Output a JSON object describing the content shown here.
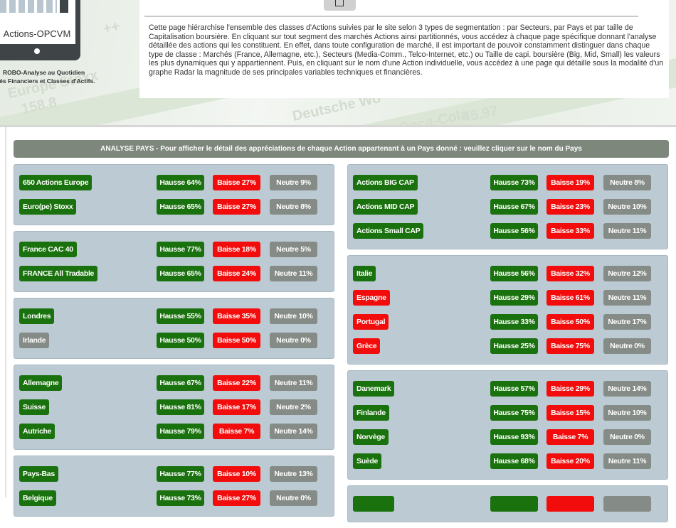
{
  "logo": {
    "text": "Actions-OPCVM",
    "tagline_1": "ROBO-Analyse au Quotidien",
    "tagline_2": "nés Financiers et Classes d'Actifs."
  },
  "background_ticker": [
    "Europe Stoxx",
    "158.8",
    "Deutsche Wo",
    "Coca-Cola",
    "45.97",
    "++"
  ],
  "intro": {
    "text": "Cette page hiérarchise l'ensemble des classes d'Actions suivies par le site selon 3 types de segmentation : par Secteurs, par Pays et par taille de Capitalisation boursière. En cliquant sur tout segment des marchés Actions ainsi partitionnés, vous accédez à chaque page spécifique donnant l'analyse détaillée des actions qui les constituent. En effet, dans toute configuration de marché, il est important de pouvoir constamment distinguer dans chaque type de classe : Marchés (France, Allemagne, etc.), Secteurs (Media-Comm., Telco-Internet, etc.) ou Taille de capi. boursière (Big, Mid, Small) les valeurs les plus dynamiques qui y appartiennent. Puis, en cliquant sur le nom d'une Action individuelle, vous accédez à une page qui détaille sous la modalité d'un graphe Radar la magnitude de ses principales variables techniques et financières.",
    "pdf_icon": "document-icon"
  },
  "section_title": "ANALYSE PAYS - Pour afficher le détail des appréciations de chaque Action appartenant à un Pays donné : veuillez cliquer sur le nom du Pays",
  "colors": {
    "green": "#1a720e",
    "red": "#f20c0c",
    "gray": "#858b86",
    "panel": "#bccbd3",
    "header": "#7d877c"
  },
  "left": [
    [
      {
        "name": "650 Actions Europe",
        "color": "green",
        "h": "Hausse 64%",
        "b": "Baisse 27%",
        "n": "Neutre 9%"
      },
      {
        "name": "Euro(pe) Stoxx",
        "color": "green",
        "h": "Hausse 65%",
        "b": "Baisse 27%",
        "n": "Neutre 8%"
      }
    ],
    [
      {
        "name": "France CAC 40",
        "color": "green",
        "h": "Hausse 77%",
        "b": "Baisse 18%",
        "n": "Neutre 5%"
      },
      {
        "name": "FRANCE All Tradable",
        "color": "green",
        "h": "Hausse 65%",
        "b": "Baisse 24%",
        "n": "Neutre 11%"
      }
    ],
    [
      {
        "name": "Londres",
        "color": "green",
        "h": "Hausse 55%",
        "b": "Baisse 35%",
        "n": "Neutre 10%"
      },
      {
        "name": "Irlande",
        "color": "gray",
        "h": "Hausse 50%",
        "b": "Baisse 50%",
        "n": "Neutre 0%"
      }
    ],
    [
      {
        "name": "Allemagne",
        "color": "green",
        "h": "Hausse 67%",
        "b": "Baisse 22%",
        "n": "Neutre 11%"
      },
      {
        "name": "Suisse",
        "color": "green",
        "h": "Hausse 81%",
        "b": "Baisse 17%",
        "n": "Neutre 2%"
      },
      {
        "name": "Autriche",
        "color": "green",
        "h": "Hausse 79%",
        "b": "Baisse 7%",
        "n": "Neutre 14%"
      }
    ],
    [
      {
        "name": "Pays-Bas",
        "color": "green",
        "h": "Hausse 77%",
        "b": "Baisse 10%",
        "n": "Neutre 13%"
      },
      {
        "name": "Belgique",
        "color": "green",
        "h": "Hausse 73%",
        "b": "Baisse 27%",
        "n": "Neutre 0%"
      }
    ]
  ],
  "right": [
    [
      {
        "name": "Actions BIG CAP",
        "color": "green",
        "h": "Hausse 73%",
        "b": "Baisse 19%",
        "n": "Neutre 8%"
      },
      {
        "name": "Actions MID CAP",
        "color": "green",
        "h": "Hausse 67%",
        "b": "Baisse 23%",
        "n": "Neutre 10%"
      },
      {
        "name": "Actions Small CAP",
        "color": "green",
        "h": "Hausse 56%",
        "b": "Baisse 33%",
        "n": "Neutre 11%"
      }
    ],
    [
      {
        "name": "Italie",
        "color": "green",
        "h": "Hausse 56%",
        "b": "Baisse 32%",
        "n": "Neutre 12%"
      },
      {
        "name": "Espagne",
        "color": "red",
        "h": "Hausse 29%",
        "b": "Baisse 61%",
        "n": "Neutre 11%"
      },
      {
        "name": "Portugal",
        "color": "red",
        "h": "Hausse 33%",
        "b": "Baisse 50%",
        "n": "Neutre 17%"
      },
      {
        "name": "Grèce",
        "color": "red",
        "h": "Hausse 25%",
        "b": "Baisse 75%",
        "n": "Neutre 0%"
      }
    ],
    [
      {
        "name": "Danemark",
        "color": "green",
        "h": "Hausse 57%",
        "b": "Baisse 29%",
        "n": "Neutre 14%"
      },
      {
        "name": "Finlande",
        "color": "green",
        "h": "Hausse 75%",
        "b": "Baisse 15%",
        "n": "Neutre 10%"
      },
      {
        "name": "Norvège",
        "color": "green",
        "h": "Hausse 93%",
        "b": "Baisse 7%",
        "n": "Neutre 0%"
      },
      {
        "name": "Suède",
        "color": "green",
        "h": "Hausse 68%",
        "b": "Baisse 20%",
        "n": "Neutre 11%"
      }
    ],
    [
      {
        "name": "",
        "color": "green",
        "h": "",
        "b": "",
        "n": ""
      }
    ]
  ]
}
